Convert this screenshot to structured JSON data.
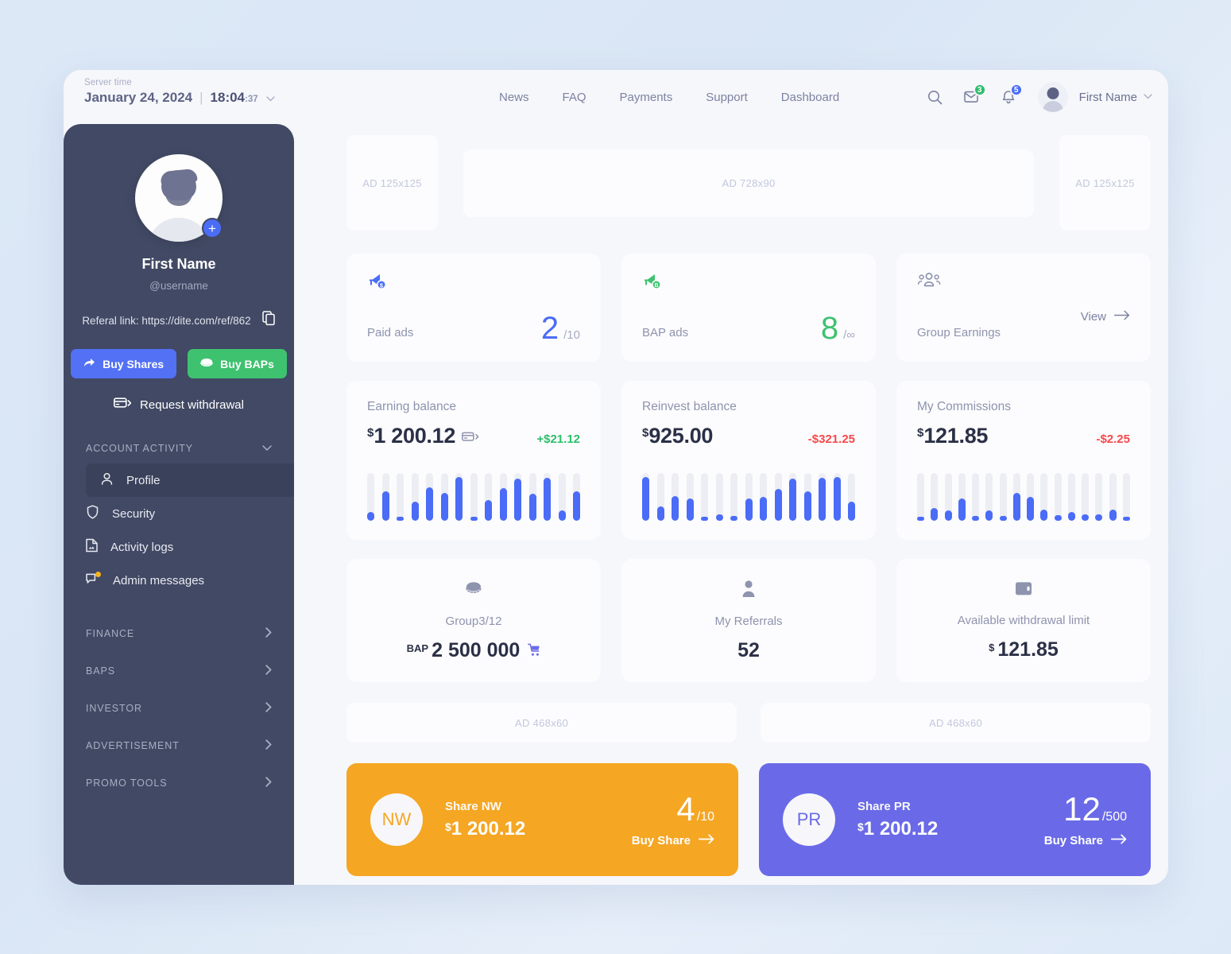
{
  "server_time": {
    "label": "Server time",
    "date": "January 24, 2024",
    "separator": "|",
    "time": "18:04",
    "seconds": ":37",
    "caret": "chevron-down-icon"
  },
  "nav": {
    "items": [
      {
        "label": "News"
      },
      {
        "label": "FAQ"
      },
      {
        "label": "Payments"
      },
      {
        "label": "Support"
      },
      {
        "label": "Dashboard"
      }
    ],
    "search_icon": "search-icon",
    "mail": {
      "icon": "mail-icon",
      "badge": "3",
      "badge_color": "#2dbe6c"
    },
    "bell": {
      "icon": "bell-icon",
      "badge": "5",
      "badge_color": "#4a6cf7"
    },
    "user": {
      "name": "First Name",
      "avatar": "avatar-icon",
      "caret": "chevron-down-icon"
    }
  },
  "sidebar": {
    "profile": {
      "name": "First Name",
      "handle": "@username",
      "add_photo": "+",
      "referal_label": "Referal link: https://dite.com/ref/862",
      "copy_icon": "copy-icon"
    },
    "buttons": {
      "buy_shares": "Buy Shares",
      "buy_baps": "Buy BAPs",
      "request_withdrawal": "Request withdrawal"
    },
    "account_activity": {
      "title": "ACCOUNT ACTIVITY",
      "items": [
        {
          "label": "Profile",
          "icon": "user-icon",
          "active": true
        },
        {
          "label": "Security",
          "icon": "shield-icon",
          "active": false
        },
        {
          "label": "Activity logs",
          "icon": "document-icon",
          "active": false
        },
        {
          "label": "Admin messages",
          "icon": "chat-icon",
          "active": false,
          "dot": true
        }
      ]
    },
    "groups": [
      {
        "label": "FINANCE"
      },
      {
        "label": "BAPS"
      },
      {
        "label": "INVESTOR"
      },
      {
        "label": "ADVERTISEMENT"
      },
      {
        "label": "PROMO TOOLS"
      }
    ]
  },
  "ads": {
    "left_125": "AD 125x125",
    "banner_728": "AD 728x90",
    "right_125": "AD 125x125",
    "bottom_left_468": "AD 468x60",
    "bottom_right_468": "AD 468x60"
  },
  "stat_cards": [
    {
      "label": "Paid ads",
      "value": "2",
      "sub": "/10",
      "icon": "megaphone-dollar-icon",
      "color": "#4a6cf7"
    },
    {
      "label": "BAP ads",
      "value": "8",
      "sub": "/∞",
      "icon": "megaphone-bap-icon",
      "color": "#3ec26f"
    },
    {
      "label": "Group Earnings",
      "view": "View",
      "icon": "group-icon",
      "color": "#8e93ae"
    }
  ],
  "balance_cards": [
    {
      "title": "Earning balance",
      "currency": "$",
      "amount": "1 200.12",
      "has_card_icon": true,
      "delta": "+$21.12",
      "delta_dir": "up"
    },
    {
      "title": "Reinvest balance",
      "currency": "$",
      "amount": "925.00",
      "has_card_icon": false,
      "delta": "-$321.25",
      "delta_dir": "down"
    },
    {
      "title": "My Commissions",
      "currency": "$",
      "amount": "121.85",
      "has_card_icon": false,
      "delta": "-$2.25",
      "delta_dir": "down"
    }
  ],
  "chart_data": [
    {
      "type": "bar",
      "title": "Earning balance",
      "categories": [
        "1",
        "2",
        "3",
        "4",
        "5",
        "6",
        "7",
        "8",
        "9",
        "10",
        "11",
        "12",
        "13",
        "14",
        "15"
      ],
      "values": [
        18,
        62,
        6,
        40,
        70,
        58,
        92,
        6,
        44,
        68,
        88,
        56,
        90,
        22,
        62
      ],
      "track_values": [
        100,
        100,
        100,
        100,
        100,
        100,
        100,
        100,
        100,
        100,
        100,
        100,
        100,
        100,
        100
      ],
      "ylim": [
        0,
        100
      ],
      "grid": false,
      "xlabel": "",
      "ylabel": "",
      "series_color": "#4a6cf7",
      "track_color": "#edeef3"
    },
    {
      "type": "bar",
      "title": "Reinvest balance",
      "categories": [
        "1",
        "2",
        "3",
        "4",
        "5",
        "6",
        "7",
        "8",
        "9",
        "10",
        "11",
        "12",
        "13",
        "14",
        "15"
      ],
      "values": [
        92,
        30,
        52,
        46,
        8,
        14,
        10,
        46,
        50,
        66,
        88,
        62,
        90,
        92,
        40
      ],
      "track_values": [
        100,
        100,
        100,
        100,
        100,
        100,
        100,
        100,
        100,
        100,
        100,
        100,
        100,
        100,
        100
      ],
      "ylim": [
        0,
        100
      ],
      "grid": false,
      "xlabel": "",
      "ylabel": "",
      "series_color": "#4a6cf7",
      "track_color": "#edeef3"
    },
    {
      "type": "bar",
      "title": "My Commissions",
      "categories": [
        "1",
        "2",
        "3",
        "4",
        "5",
        "6",
        "7",
        "8",
        "9",
        "10",
        "11",
        "12",
        "13",
        "14",
        "15"
      ],
      "values": [
        8,
        26,
        22,
        46,
        10,
        22,
        10,
        58,
        50,
        24,
        12,
        18,
        14,
        14,
        24,
        8
      ],
      "track_values": [
        100,
        100,
        100,
        100,
        100,
        100,
        100,
        100,
        100,
        100,
        100,
        100,
        100,
        100,
        100,
        100
      ],
      "ylim": [
        0,
        100
      ],
      "grid": false,
      "xlabel": "",
      "ylabel": "",
      "series_color": "#4a6cf7",
      "track_color": "#edeef3"
    }
  ],
  "mini_cards": [
    {
      "label": "Group3/12",
      "unit": "BAP",
      "value": "2 500 000",
      "icon": "coin-icon",
      "trailing_icon": "cart-icon"
    },
    {
      "label": "My Referrals",
      "unit": "",
      "value": "52",
      "icon": "person-icon",
      "trailing_icon": ""
    },
    {
      "label": "Available withdrawal limit",
      "unit": "$",
      "value": "121.85",
      "icon": "wallet-icon",
      "trailing_icon": ""
    }
  ],
  "share_cards": [
    {
      "initials": "NW",
      "name": "Share NW",
      "currency": "$",
      "amount": "1 200.12",
      "count": "4",
      "total": "/10",
      "buy": "Buy Share",
      "color": "#f5a623"
    },
    {
      "initials": "PR",
      "name": "Share PR",
      "currency": "$",
      "amount": "1 200.12",
      "count": "12",
      "total": "/500",
      "buy": "Buy Share",
      "color": "#6a6ae8"
    }
  ]
}
